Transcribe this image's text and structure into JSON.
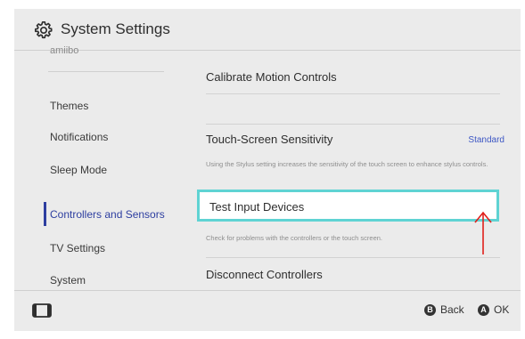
{
  "header": {
    "title": "System Settings",
    "icon": "gear-icon"
  },
  "sidebar": {
    "partial_item": "amiibo",
    "items": [
      {
        "label": "Themes",
        "active": false
      },
      {
        "label": "Notifications",
        "active": false
      },
      {
        "label": "Sleep Mode",
        "active": false
      },
      {
        "label": "Controllers and Sensors",
        "active": true
      },
      {
        "label": "TV Settings",
        "active": false
      },
      {
        "label": "System",
        "active": false
      }
    ]
  },
  "content": {
    "rows": [
      {
        "title": "Calibrate Motion Controls"
      },
      {
        "title": "Touch-Screen Sensitivity",
        "value": "Standard",
        "description": "Using the Stylus setting increases the sensitivity of the touch screen to enhance stylus controls."
      },
      {
        "title": "Test Input Devices",
        "description": "Check for problems with the controllers or the touch screen."
      },
      {
        "title": "Disconnect Controllers"
      }
    ]
  },
  "footer": {
    "console_icon": "console-icon",
    "back": {
      "button": "B",
      "label": "Back"
    },
    "ok": {
      "button": "A",
      "label": "OK"
    }
  },
  "colors": {
    "accent": "#2d3ea0",
    "selection": "#5fd3d3",
    "value": "#3d57c4",
    "annotation": "#e0201b"
  }
}
